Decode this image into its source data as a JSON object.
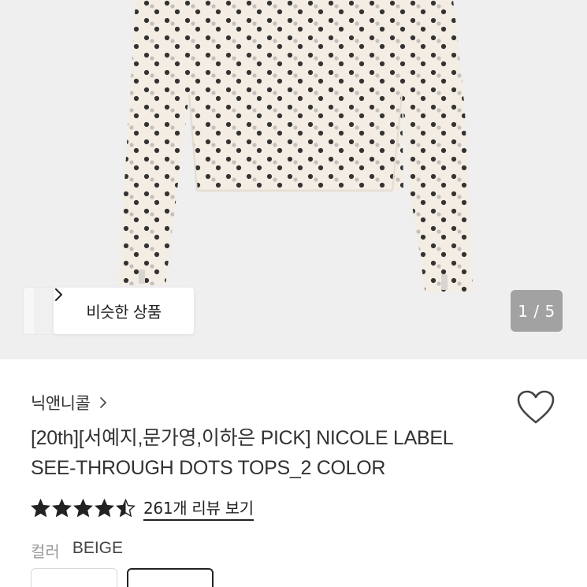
{
  "product_image": {
    "pager_text": "1 / 5",
    "similar_button_label": "비슷한 상품"
  },
  "brand": {
    "name": "닉앤니콜"
  },
  "product": {
    "title_line1": "[20th][서예지,문가영,이하은 PICK] NICOLE LABEL",
    "title_line2": "SEE-THROUGH DOTS TOPS_2 COLOR",
    "rating": 4.5,
    "review_link": "261개 리뷰 보기"
  },
  "color_option": {
    "label": "컬러",
    "selected_value": "BEIGE"
  },
  "colors": {
    "hero_bg": "#efefef",
    "garment": "#f3ede4",
    "dot": "#1e1e1e"
  }
}
